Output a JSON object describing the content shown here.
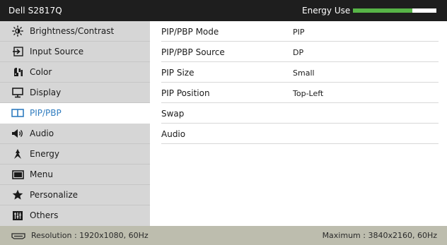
{
  "header": {
    "model": "Dell S2817Q",
    "energy_label": "Energy Use",
    "energy_level": 0.71,
    "colors": {
      "bar_bg": "#1e1e1e",
      "energy_fill": "#57b447"
    }
  },
  "sidebar": {
    "items": [
      {
        "label": "Brightness/Contrast",
        "icon": "brightness-icon"
      },
      {
        "label": "Input Source",
        "icon": "input-source-icon"
      },
      {
        "label": "Color",
        "icon": "color-icon"
      },
      {
        "label": "Display",
        "icon": "display-icon"
      },
      {
        "label": "PIP/PBP",
        "icon": "pip-icon",
        "selected": true
      },
      {
        "label": "Audio",
        "icon": "speaker-icon"
      },
      {
        "label": "Energy",
        "icon": "energy-icon"
      },
      {
        "label": "Menu",
        "icon": "menu-icon"
      },
      {
        "label": "Personalize",
        "icon": "star-icon"
      },
      {
        "label": "Others",
        "icon": "others-icon"
      }
    ],
    "selected_color": "#2f7cbf"
  },
  "settings": [
    {
      "label": "PIP/PBP Mode",
      "value": "PIP"
    },
    {
      "label": "PIP/PBP Source",
      "value": "DP"
    },
    {
      "label": "PIP Size",
      "value": "Small"
    },
    {
      "label": "PIP Position",
      "value": "Top-Left"
    },
    {
      "label": "Swap",
      "value": ""
    },
    {
      "label": "Audio",
      "value": ""
    }
  ],
  "status": {
    "resolution": "Resolution : 1920x1080, 60Hz",
    "maximum": "Maximum : 3840x2160, 60Hz"
  }
}
